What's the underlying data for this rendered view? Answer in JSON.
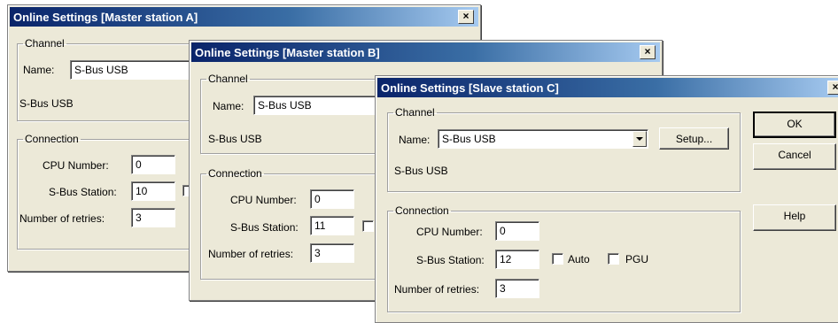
{
  "dialog_a": {
    "title": "Online Settings [Master station A]",
    "channel_legend": "Channel",
    "name_label": "Name:",
    "name_value": "S-Bus USB",
    "channel_desc": "S-Bus USB",
    "connection_legend": "Connection",
    "cpu_label": "CPU Number:",
    "cpu_value": "0",
    "station_label": "S-Bus Station:",
    "station_value": "10",
    "retries_label": "Number of retries:",
    "retries_value": "3",
    "close_glyph": "×"
  },
  "dialog_b": {
    "title": "Online Settings [Master station B]",
    "channel_legend": "Channel",
    "name_label": "Name:",
    "name_value": "S-Bus USB",
    "channel_desc": "S-Bus USB",
    "connection_legend": "Connection",
    "cpu_label": "CPU Number:",
    "cpu_value": "0",
    "station_label": "S-Bus Station:",
    "station_value": "11",
    "retries_label": "Number of retries:",
    "retries_value": "3",
    "close_glyph": "×"
  },
  "dialog_c": {
    "title": "Online Settings [Slave station C]",
    "channel_legend": "Channel",
    "name_label": "Name:",
    "name_value": "S-Bus USB",
    "setup_label": "Setup...",
    "channel_desc": "S-Bus USB",
    "connection_legend": "Connection",
    "cpu_label": "CPU Number:",
    "cpu_value": "0",
    "station_label": "S-Bus Station:",
    "station_value": "12",
    "auto_label": "Auto",
    "pgu_label": "PGU",
    "retries_label": "Number of retries:",
    "retries_value": "3",
    "ok_label": "OK",
    "cancel_label": "Cancel",
    "help_label": "Help",
    "close_glyph": "×"
  }
}
